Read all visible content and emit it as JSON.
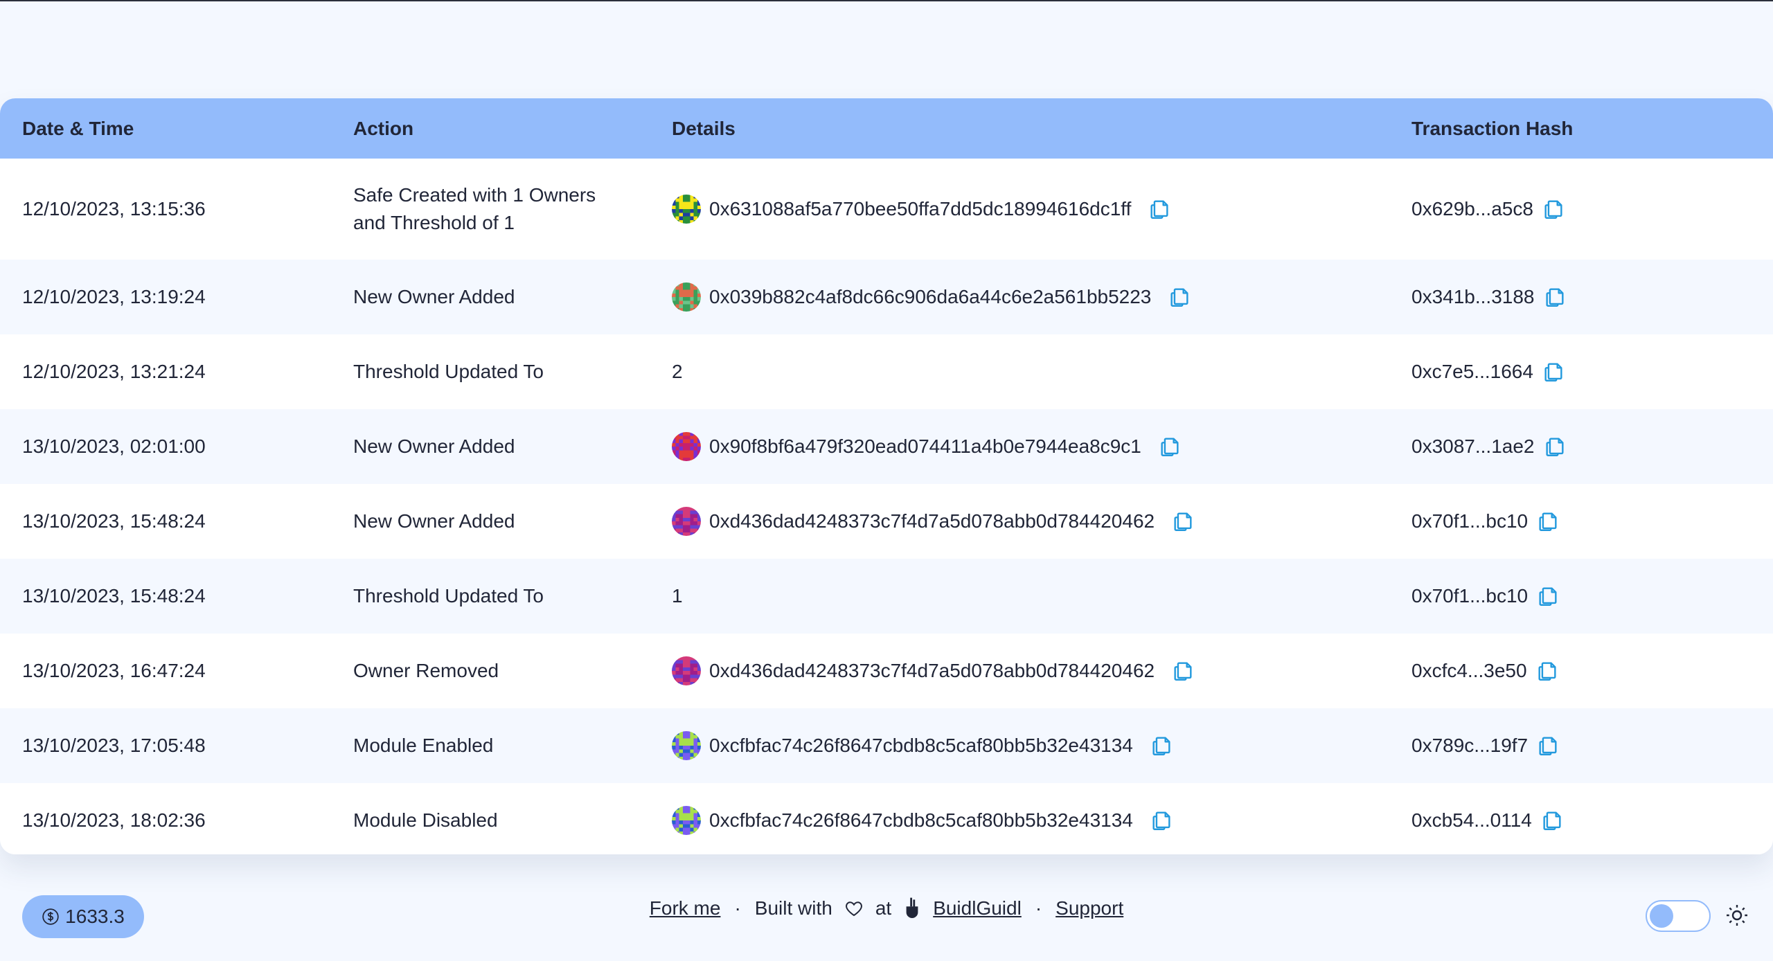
{
  "table": {
    "headers": {
      "datetime": "Date & Time",
      "action": "Action",
      "details": "Details",
      "hash": "Transaction Hash"
    },
    "rows": [
      {
        "datetime": "12/10/2023, 13:15:36",
        "action": "Safe Created with 1 Owners and Threshold of 1",
        "details": "0x631088af5a770bee50ffa7dd5dc18994616dc1ff",
        "hash": "0x629b...a5c8",
        "avatar": [
          "#2a8f3b",
          "#f5e61a",
          "#1f3fa0"
        ]
      },
      {
        "datetime": "12/10/2023, 13:19:24",
        "action": "New Owner Added",
        "details": "0x039b882c4af8dc66c906da6a44c6e2a561bb5223",
        "hash": "0x341b...3188",
        "avatar": [
          "#3aa05a",
          "#e06a4a",
          "#6bc48a"
        ]
      },
      {
        "datetime": "12/10/2023, 13:21:24",
        "action": "Threshold Updated To",
        "details": "2",
        "hash": "0xc7e5...1664",
        "avatar": null
      },
      {
        "datetime": "13/10/2023, 02:01:00",
        "action": "New Owner Added",
        "details": "0x90f8bf6a479f320ead074411a4b0e7944ea8c9c1",
        "hash": "0x3087...1ae2",
        "avatar": [
          "#c6206e",
          "#7a2fd0",
          "#e33a3a"
        ]
      },
      {
        "datetime": "13/10/2023, 15:48:24",
        "action": "New Owner Added",
        "details": "0xd436dad4248373c7f4d7a5d078abb0d784420462",
        "hash": "0x70f1...bc10",
        "avatar": [
          "#a01e8a",
          "#6a3fd0",
          "#d43a7a"
        ]
      },
      {
        "datetime": "13/10/2023, 15:48:24",
        "action": "Threshold Updated To",
        "details": "1",
        "hash": "0x70f1...bc10",
        "avatar": null
      },
      {
        "datetime": "13/10/2023, 16:47:24",
        "action": "Owner Removed",
        "details": "0xd436dad4248373c7f4d7a5d078abb0d784420462",
        "hash": "0xcfc4...3e50",
        "avatar": [
          "#a01e8a",
          "#6a3fd0",
          "#d43a7a"
        ]
      },
      {
        "datetime": "13/10/2023, 17:05:48",
        "action": "Module Enabled",
        "details": "0xcfbfac74c26f8647cbdb8c5caf80bb5b32e43134",
        "hash": "0x789c...19f7",
        "avatar": [
          "#7a5cf0",
          "#a8e04a",
          "#2a5fd0"
        ]
      },
      {
        "datetime": "13/10/2023, 18:02:36",
        "action": "Module Disabled",
        "details": "0xcfbfac74c26f8647cbdb8c5caf80bb5b32e43134",
        "hash": "0xcb54...0114",
        "avatar": [
          "#7a5cf0",
          "#a8e04a",
          "#2a5fd0"
        ]
      }
    ]
  },
  "footer": {
    "price": "1633.3",
    "fork": "Fork me",
    "built_with": "Built with",
    "at": "at",
    "buidlguidl": "BuidlGuidl",
    "support": "Support",
    "separator": "·"
  },
  "colors": {
    "accent": "#93bbfb",
    "copy_icon": "#2299dd",
    "bg": "#f4f8ff"
  }
}
